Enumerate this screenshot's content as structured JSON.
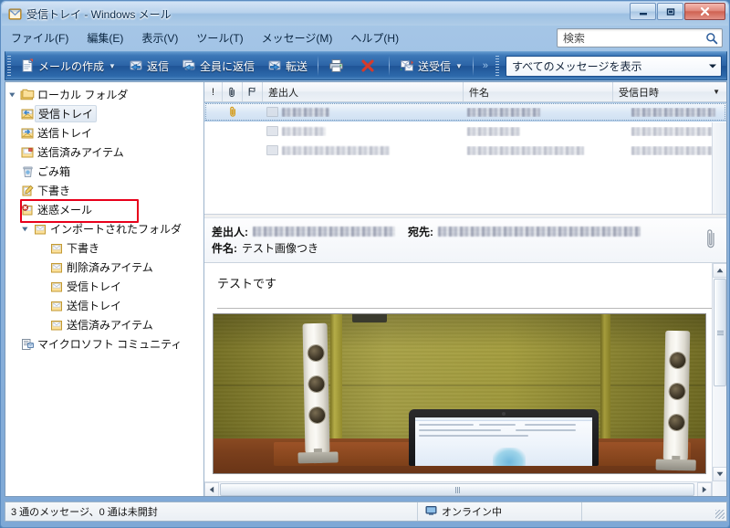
{
  "window": {
    "title": "受信トレイ - Windows メール",
    "icon": "mail-app-icon",
    "controls": {
      "minimize": "minimize-button",
      "restore": "restore-button",
      "close": "close-button"
    }
  },
  "menubar": {
    "items": [
      {
        "label": "ファイル(F)",
        "name": "menu-file"
      },
      {
        "label": "編集(E)",
        "name": "menu-edit"
      },
      {
        "label": "表示(V)",
        "name": "menu-view"
      },
      {
        "label": "ツール(T)",
        "name": "menu-tools"
      },
      {
        "label": "メッセージ(M)",
        "name": "menu-message"
      },
      {
        "label": "ヘルプ(H)",
        "name": "menu-help"
      }
    ]
  },
  "search": {
    "placeholder": "検索",
    "value": "検索",
    "icon": "search-icon"
  },
  "toolbar": {
    "create_mail": "メールの作成",
    "reply": "返信",
    "reply_all": "全員に返信",
    "forward": "転送",
    "send_receive": "送受信",
    "overflow": "»",
    "filter_value": "すべてのメッセージを表示"
  },
  "sidebar": {
    "items": [
      {
        "label": "ローカル フォルダ",
        "indent": 0,
        "expander": "collapse-arrow",
        "icon": "folders-icon",
        "selected": false,
        "highlighted": false
      },
      {
        "label": "受信トレイ",
        "indent": 1,
        "expander": "",
        "icon": "inbox-icon",
        "selected": true,
        "highlighted": false
      },
      {
        "label": "送信トレイ",
        "indent": 1,
        "expander": "",
        "icon": "outbox-icon",
        "selected": false,
        "highlighted": false
      },
      {
        "label": "送信済みアイテム",
        "indent": 1,
        "expander": "",
        "icon": "sent-items-icon",
        "selected": false,
        "highlighted": false
      },
      {
        "label": "ごみ箱",
        "indent": 1,
        "expander": "",
        "icon": "trash-icon",
        "selected": false,
        "highlighted": false
      },
      {
        "label": "下書き",
        "indent": 1,
        "expander": "",
        "icon": "drafts-icon",
        "selected": false,
        "highlighted": false
      },
      {
        "label": "迷惑メール",
        "indent": 1,
        "expander": "",
        "icon": "junk-mail-icon",
        "selected": false,
        "highlighted": true
      },
      {
        "label": "インポートされたフォルダ",
        "indent": 1,
        "expander": "collapse-arrow",
        "icon": "folder-icon",
        "selected": false,
        "highlighted": false
      },
      {
        "label": "下書き",
        "indent": 2,
        "expander": "",
        "icon": "folder-icon",
        "selected": false,
        "highlighted": false
      },
      {
        "label": "削除済みアイテム",
        "indent": 2,
        "expander": "",
        "icon": "folder-icon",
        "selected": false,
        "highlighted": false
      },
      {
        "label": "受信トレイ",
        "indent": 2,
        "expander": "",
        "icon": "folder-icon",
        "selected": false,
        "highlighted": false
      },
      {
        "label": "送信トレイ",
        "indent": 2,
        "expander": "",
        "icon": "folder-icon",
        "selected": false,
        "highlighted": false
      },
      {
        "label": "送信済みアイテム",
        "indent": 2,
        "expander": "",
        "icon": "folder-icon",
        "selected": false,
        "highlighted": false
      },
      {
        "label": "マイクロソフト コミュニティ",
        "indent": 0,
        "expander": "",
        "icon": "newsgroup-icon",
        "selected": false,
        "highlighted": false
      }
    ]
  },
  "message_list": {
    "columns": [
      {
        "label": "!",
        "name": "column-priority"
      },
      {
        "label": "",
        "name": "column-attachment"
      },
      {
        "label": "",
        "name": "column-flag"
      },
      {
        "label": "差出人",
        "name": "column-from"
      },
      {
        "label": "件名",
        "name": "column-subject"
      },
      {
        "label": "受信日時",
        "name": "column-received"
      }
    ],
    "sort_indicator": "▼",
    "rows": [
      {
        "from": "",
        "subject": "",
        "date": "",
        "has_attachment": true,
        "selected": true,
        "redacted": true
      },
      {
        "from": "",
        "subject": "",
        "date": "",
        "has_attachment": false,
        "selected": false,
        "redacted": true
      },
      {
        "from": "",
        "subject": "",
        "date": "",
        "has_attachment": false,
        "selected": false,
        "redacted": true
      }
    ]
  },
  "preview": {
    "from_label": "差出人:",
    "from_value": "",
    "to_label": "宛先:",
    "to_value": "",
    "subject_label": "件名:",
    "subject_value": "テスト画像つき",
    "attachment_icon": "paperclip-icon",
    "body_text": "テストです",
    "attached_image_alt": "laptop-and-speakers-photo"
  },
  "statusbar": {
    "message_count": "3 通のメッセージ、0 通は未開封",
    "connection_icon": "online-icon",
    "connection_status": "オンライン中"
  },
  "colors": {
    "accent": "#2b63a6",
    "highlight_box": "#e8001a",
    "titlebar": "#b8d2ec",
    "selection": "#cfe0f2"
  }
}
